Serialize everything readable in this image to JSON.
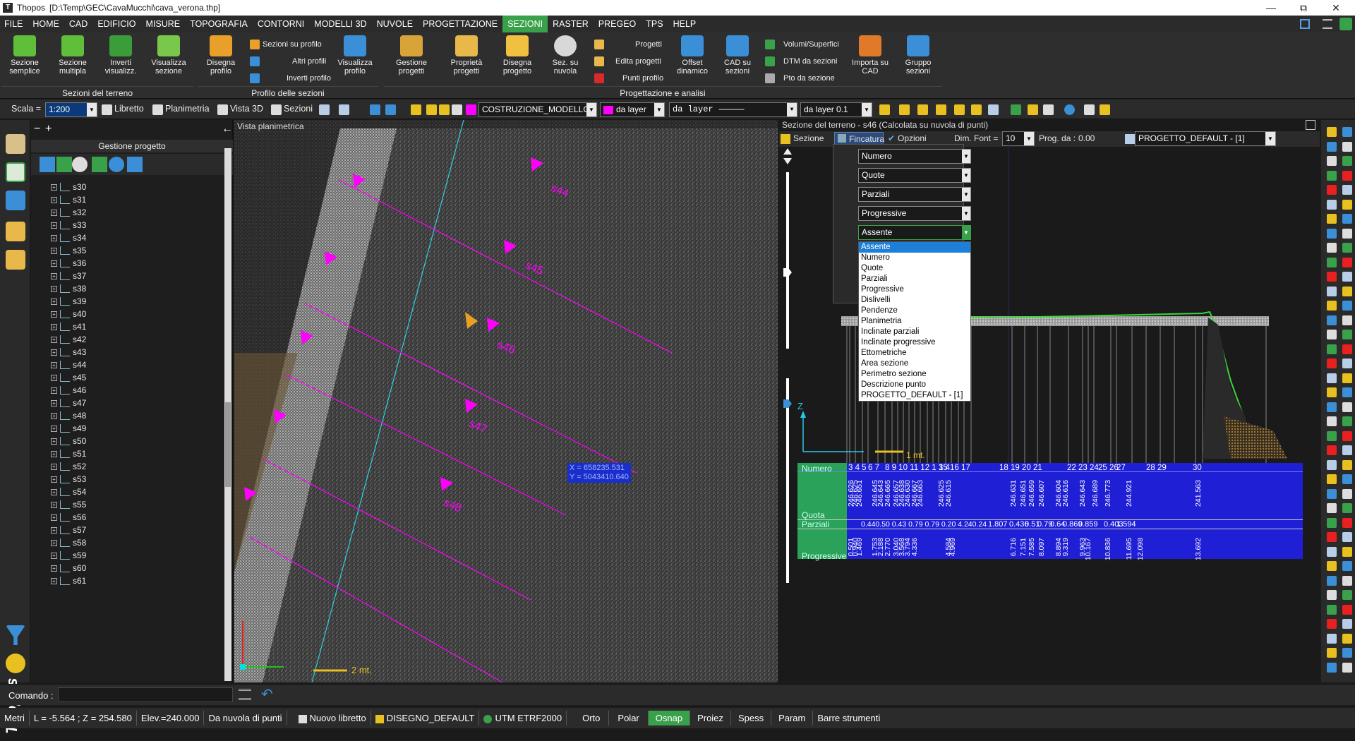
{
  "titlebar": {
    "app": "Thopos",
    "path": "[D:\\Temp\\GEC\\CavaMucchi\\cava_verona.thp]"
  },
  "menu": [
    "FILE",
    "HOME",
    "CAD",
    "EDIFICIO",
    "MISURE",
    "TOPOGRAFIA",
    "CONTORNI",
    "MODELLI 3D",
    "NUVOLE",
    "PROGETTAZIONE",
    "SEZIONI",
    "RASTER",
    "PREGEO",
    "TPS",
    "HELP"
  ],
  "menu_active": "SEZIONI",
  "ribbon": {
    "big_buttons": [
      {
        "label1": "Sezione",
        "label2": "semplice",
        "icon": "section-simple-icon",
        "color": "#5fbf3a"
      },
      {
        "label1": "Sezione",
        "label2": "multipla",
        "icon": "section-multiple-icon",
        "color": "#5fbf3a"
      },
      {
        "label1": "Inverti",
        "label2": "visualizz.",
        "icon": "invert-view-icon",
        "color": "#3a9d3a"
      },
      {
        "label1": "Visualizza",
        "label2": "sezione",
        "icon": "view-section-icon",
        "color": "#79c84b"
      },
      {
        "label1": "Disegna",
        "label2": "profilo",
        "icon": "draw-profile-icon",
        "color": "#e8a02a"
      },
      {
        "label1": "Visualizza",
        "label2": "profilo",
        "icon": "view-profile-icon",
        "color": "#3b8fd6"
      },
      {
        "label1": "Gestione",
        "label2": "progetti",
        "icon": "manage-projects-icon",
        "color": "#d8a43a"
      },
      {
        "label1": "Proprietà",
        "label2": "progetti",
        "icon": "project-properties-icon",
        "color": "#e8b84a"
      },
      {
        "label1": "Disegna",
        "label2": "progetto",
        "icon": "draw-project-icon",
        "color": "#f0c040"
      },
      {
        "label1": "Sez. su",
        "label2": "nuvola",
        "icon": "cloud-section-icon",
        "color": "#d8d8d8"
      },
      {
        "label1": "Offset",
        "label2": "dinamico",
        "icon": "dynamic-offset-icon",
        "color": "#3b8fd6"
      },
      {
        "label1": "CAD su",
        "label2": "sezioni",
        "icon": "cad-sections-icon",
        "color": "#3b8fd6"
      },
      {
        "label1": "Importa su",
        "label2": "CAD",
        "icon": "import-cad-icon",
        "color": "#e07a2a"
      },
      {
        "label1": "Gruppo",
        "label2": "sezioni",
        "icon": "section-group-icon",
        "color": "#3b8fd6"
      }
    ],
    "small_buttons": {
      "profilo": [
        "Sezioni su profilo",
        "Altri profili",
        "Inverti profilo"
      ],
      "progetti": [
        "Progetti",
        "Edita progetti",
        "Punti profilo"
      ],
      "volumi": [
        "Volumi/Superfici",
        "DTM da sezioni",
        "Pto da sezione"
      ]
    },
    "groups": [
      "Sezioni del terreno",
      "Profilo delle sezioni",
      "Progettazione e analisi"
    ]
  },
  "toolbar": {
    "scale_label": "Scala =",
    "scale_value": "1:200",
    "libretto": "Libretto",
    "planimetria": "Planimetria",
    "vista3d": "Vista 3D",
    "sezioni": "Sezioni",
    "layer": "COSTRUZIONE_MODELLO",
    "color": "da layer",
    "linetype": "da layer",
    "lineweight": "da layer 0.1"
  },
  "project_panel": {
    "title": "Gestione progetto",
    "items": [
      "s30",
      "s31",
      "s32",
      "s33",
      "s34",
      "s35",
      "s36",
      "s37",
      "s38",
      "s39",
      "s40",
      "s41",
      "s42",
      "s43",
      "s44",
      "s45",
      "s46",
      "s47",
      "s48",
      "s49",
      "s50",
      "s51",
      "s52",
      "s53",
      "s54",
      "s55",
      "s56",
      "s57",
      "s58",
      "s59",
      "s60",
      "s61"
    ]
  },
  "plan_view": {
    "caption": "Vista planimetrica",
    "section_labels": [
      "s44",
      "s45",
      "s46",
      "s47",
      "s48"
    ],
    "coord_x": "X = 658235.531",
    "coord_y": "Y = 5043410.640",
    "scale_text": "2 mt."
  },
  "section_view": {
    "caption": "Sezione del terreno - s46 (Calcolata su nuvola di punti)",
    "sezione_label": "Sezione",
    "fincatura_label": "Fincatura",
    "opzioni_label": "Opzioni",
    "dim_font_label": "Dim. Font =",
    "dim_font_value": "10",
    "prog_label": "Prog. da :",
    "prog_value": "0.00",
    "project_value": "PROGETTO_DEFAULT - [1]",
    "option_combos": [
      "Numero",
      "Quote",
      "Parziali",
      "Progressive",
      "Assente"
    ],
    "dropdown_items": [
      "Assente",
      "Numero",
      "Quote",
      "Parziali",
      "Progressive",
      "Dislivelli",
      "Pendenze",
      "Planimetria",
      "Inclinate parziali",
      "Inclinate progressive",
      "Ettometriche",
      "Area sezione",
      "Perimetro sezione",
      "Descrizione punto",
      "PROGETTO_DEFAULT - [1]"
    ],
    "dropdown_selected": "Assente",
    "axis_z": "Z",
    "scale_text": "1 mt.",
    "row_labels": [
      "Numero",
      "Quota",
      "Parziali",
      "Progressive"
    ],
    "numbers": [
      "3 4 5",
      "6 7",
      "8 9 10 11 12 1 3 4",
      "15 16 17",
      "18 19 20 21",
      "22 23 24",
      "25 26",
      "27",
      "28 29",
      "30"
    ],
    "quote": [
      "246.626",
      "246.625",
      "246.651",
      "246.645",
      "246.643",
      "246.665",
      "246.657",
      "246.638",
      "246.630",
      "246.667",
      "246.663",
      "246.625",
      "246.615",
      "246.631",
      "246.651",
      "246.659",
      "246.607",
      "246.604",
      "246.616",
      "246.643",
      "246.689",
      "246.773",
      "244.921",
      "241.563"
    ],
    "parziali_text": "0.440.50 0.43 0.79 0.79 0.20 4.240.24",
    "parziali_vals": [
      "1.807",
      "0.436",
      "0.51",
      "0.79",
      "0.64",
      "0.869",
      "0.859",
      "0.403",
      "1.594"
    ],
    "progressive": [
      "0.501",
      "0.940",
      "1.469",
      "1.753",
      "2.188",
      "2.770",
      "3.040",
      "3.568",
      "3.794",
      "4.336",
      "4.584",
      "4.969",
      "6.716",
      "7.151",
      "7.585",
      "8.097",
      "8.894",
      "9.319",
      "9.963",
      "10.167",
      "10.836",
      "11.695",
      "12.098",
      "13.692"
    ]
  },
  "command": {
    "label": "Comando :",
    "value": ""
  },
  "status": [
    "Metri",
    "L = -5.564 ; Z = 254.580",
    "Elev.=240.000",
    "Da nuvola di punti",
    "Nuovo libretto",
    "DISEGNO_DEFAULT",
    "UTM ETRF2000",
    "Orto",
    "Polar",
    "Osnap",
    "Proiez",
    "Spess",
    "Param",
    "Barre strumenti"
  ],
  "status_active": "Osnap",
  "colors": {
    "accent": "#3aa14b",
    "magenta": "#ff00ff",
    "table_blue": "#1f1fd6",
    "profile_green": "#3ad63a",
    "cyan": "#2fd0e0"
  }
}
